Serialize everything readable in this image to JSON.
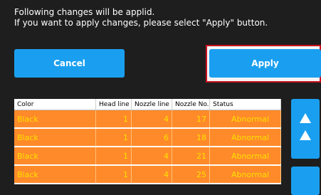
{
  "message": {
    "line1": "Following changes will be applid.",
    "line2": "If you want to apply changes, please select \"Apply\" button."
  },
  "buttons": {
    "cancel": "Cancel",
    "apply": "Apply"
  },
  "table": {
    "columns": [
      "Color",
      "Head line",
      "Nozzle line",
      "Nozzle No.",
      "Status"
    ],
    "rows": [
      [
        "Black",
        "1",
        "4",
        "17",
        "Abnormal"
      ],
      [
        "Black",
        "1",
        "6",
        "18",
        "Abnormal"
      ],
      [
        "Black",
        "1",
        "4",
        "21",
        "Abnormal"
      ],
      [
        "Black",
        "1",
        "4",
        "25",
        "Abnormal"
      ]
    ]
  },
  "colors": {
    "background": "#1e1e1e",
    "button": "#1a9ff0",
    "row_fill": "#ff8a2a",
    "row_text": "#ffe100",
    "highlight_border": "#c8101e"
  },
  "icons": {
    "scroll_up": "double-up-arrow-icon",
    "scroll_down": "scroll-down-button"
  }
}
